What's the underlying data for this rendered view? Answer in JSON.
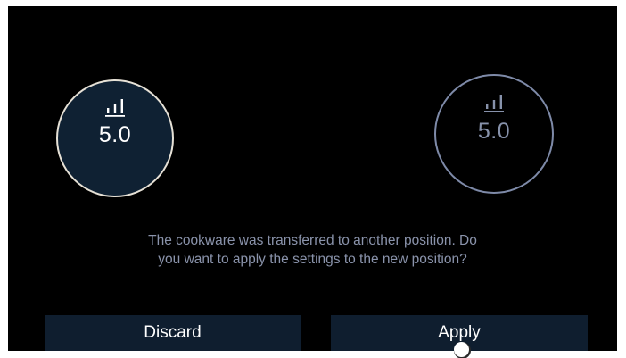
{
  "zones": {
    "current": {
      "level": "5.0",
      "icon": "power-level-icon"
    },
    "new": {
      "level": "5.0",
      "icon": "power-level-icon"
    }
  },
  "dialog": {
    "message": "The cookware was transferred to another position. Do you want to apply the settings to the new position?"
  },
  "buttons": {
    "discard_label": "Discard",
    "apply_label": "Apply"
  },
  "colors": {
    "background": "#000000",
    "zone_fill": "#0f2133",
    "zone_active_border": "#e6e1d6",
    "zone_target_border": "#7e8aa8",
    "muted_text": "#8a93ab",
    "button_fill": "#0f1e2f"
  }
}
